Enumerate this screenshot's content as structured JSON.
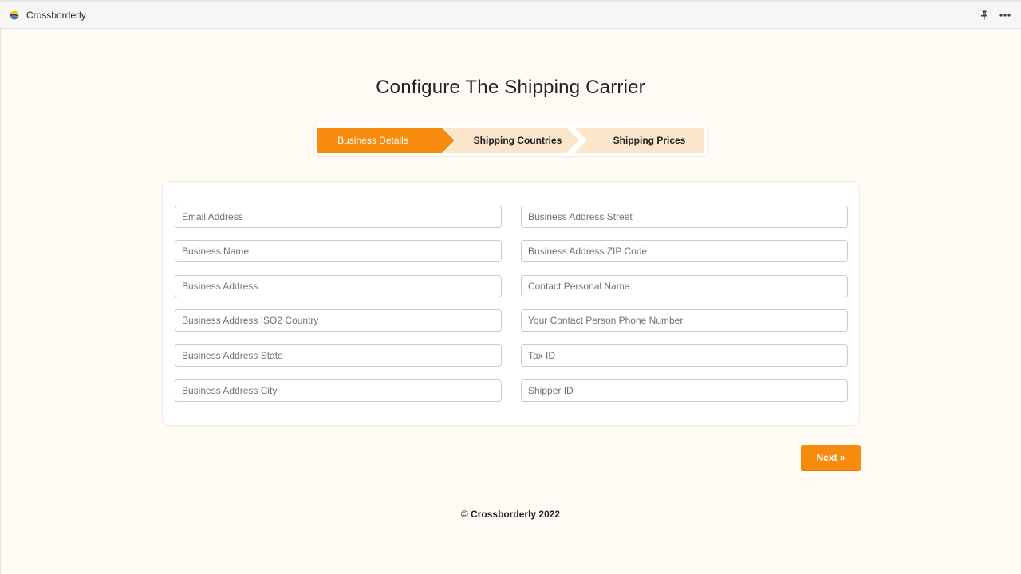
{
  "app": {
    "name": "Crossborderly",
    "logo_icon": "crossborderly-logo-icon",
    "actions": [
      {
        "icon": "pin-icon"
      },
      {
        "icon": "more-options-icon"
      }
    ]
  },
  "page": {
    "title": "Configure The Shipping Carrier"
  },
  "steps": [
    {
      "label": "Business Details",
      "active": true
    },
    {
      "label": "Shipping Countries",
      "active": false
    },
    {
      "label": "Shipping Prices",
      "active": false
    }
  ],
  "form": {
    "left": [
      {
        "placeholder": "Email Address",
        "value": ""
      },
      {
        "placeholder": "Business Name",
        "value": ""
      },
      {
        "placeholder": "Business Address",
        "value": ""
      },
      {
        "placeholder": "Business Address ISO2 Country",
        "value": ""
      },
      {
        "placeholder": "Business Address State",
        "value": ""
      },
      {
        "placeholder": "Business Address City",
        "value": ""
      }
    ],
    "right": [
      {
        "placeholder": "Business Address Street",
        "value": ""
      },
      {
        "placeholder": "Business Address ZIP Code",
        "value": ""
      },
      {
        "placeholder": "Contact Personal Name",
        "value": ""
      },
      {
        "placeholder": "Your Contact Person Phone Number",
        "value": ""
      },
      {
        "placeholder": "Tax ID",
        "value": ""
      },
      {
        "placeholder": "Shipper ID",
        "value": ""
      }
    ]
  },
  "next_button": {
    "label": "Next »"
  },
  "footer": {
    "text": "© Crossborderly 2022"
  },
  "colors": {
    "accent": "#f68b0e",
    "step_inactive": "#fbe5cb",
    "page_background": "#fffaf4"
  }
}
